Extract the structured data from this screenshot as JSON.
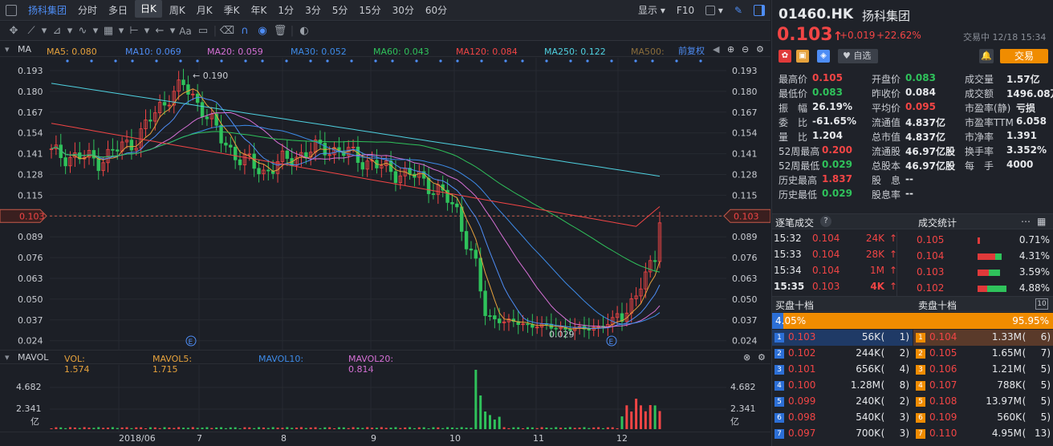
{
  "toolbar": {
    "stock_name": "扬科集团",
    "periods": [
      "分时",
      "多日",
      "日K",
      "周K",
      "月K",
      "季K",
      "年K",
      "1分",
      "3分",
      "5分",
      "15分",
      "30分",
      "60分"
    ],
    "selected_period": "日K",
    "display_label": "显示",
    "f10_label": "F10"
  },
  "ma_legend": {
    "title": "MA",
    "items": [
      {
        "label": "MA5: 0.080",
        "color": "#e6a23c"
      },
      {
        "label": "MA10: 0.069",
        "color": "#4e8df5"
      },
      {
        "label": "MA20: 0.059",
        "color": "#d670d6"
      },
      {
        "label": "MA30: 0.052",
        "color": "#3d8be8"
      },
      {
        "label": "MA60: 0.043",
        "color": "#2fc25b"
      },
      {
        "label": "MA120: 0.084",
        "color": "#f24545"
      },
      {
        "label": "MA250: 0.122",
        "color": "#4fd1e0"
      },
      {
        "label": "MA500:",
        "color": "#8a6d3b"
      }
    ],
    "adjust_label": "前复权"
  },
  "price_axis": {
    "ticks": [
      "0.193",
      "0.180",
      "0.167",
      "0.154",
      "0.141",
      "0.128",
      "0.115",
      "0.103",
      "0.089",
      "0.076",
      "0.063",
      "0.050",
      "0.037",
      "0.024"
    ],
    "current": "0.103"
  },
  "chart_annotations": {
    "high_label": "0.190",
    "low_label": "0.029",
    "event_marker": "E"
  },
  "vol_legend": {
    "title": "MAVOL",
    "items": [
      {
        "label": "VOL: 1.574",
        "color": "#e6a23c"
      },
      {
        "label": "MAVOL5: 1.715",
        "color": "#e6a23c"
      },
      {
        "label": "MAVOL10:",
        "color": "#3d8be8"
      },
      {
        "label": "MAVOL20: 0.814",
        "color": "#d670d6"
      }
    ]
  },
  "vol_axis": {
    "ticks": [
      "4.682",
      "2.341"
    ],
    "unit": "亿"
  },
  "x_axis": [
    "2018/06",
    "7",
    "8",
    "9",
    "10",
    "11",
    "12"
  ],
  "quote": {
    "code": "01460.HK",
    "name": "扬科集团",
    "price": "0.103",
    "change": "+0.019",
    "change_pct": "+22.62%",
    "status": "交易中 12/18 15:34",
    "watch_label": "自选",
    "trade_label": "交易"
  },
  "stats": [
    [
      {
        "k": "最高价",
        "v": "0.105",
        "c": "red"
      },
      {
        "k": "开盘价",
        "v": "0.083",
        "c": "green"
      },
      {
        "k": "成交量",
        "v": "1.57亿",
        "c": "white"
      }
    ],
    [
      {
        "k": "最低价",
        "v": "0.083",
        "c": "green"
      },
      {
        "k": "昨收价",
        "v": "0.084",
        "c": "white"
      },
      {
        "k": "成交额",
        "v": "1496.08万",
        "c": "white"
      }
    ],
    [
      {
        "k": "振　幅",
        "v": "26.19%",
        "c": "white"
      },
      {
        "k": "平均价",
        "v": "0.095",
        "c": "red"
      },
      {
        "k": "市盈率(静)",
        "v": "亏损",
        "c": "white"
      }
    ],
    [
      {
        "k": "委　比",
        "v": "-61.65%",
        "c": "white"
      },
      {
        "k": "流通值",
        "v": "4.837亿",
        "c": "white"
      },
      {
        "k": "市盈率TTM",
        "v": "6.058",
        "c": "white"
      }
    ],
    [
      {
        "k": "量　比",
        "v": "1.204",
        "c": "white"
      },
      {
        "k": "总市值",
        "v": "4.837亿",
        "c": "white"
      },
      {
        "k": "市净率",
        "v": "1.391",
        "c": "white"
      }
    ],
    [
      {
        "k": "52周最高",
        "v": "0.200",
        "c": "red"
      },
      {
        "k": "流通股",
        "v": "46.97亿股",
        "c": "white"
      },
      {
        "k": "换手率",
        "v": "3.352%",
        "c": "white"
      }
    ],
    [
      {
        "k": "52周最低",
        "v": "0.029",
        "c": "green"
      },
      {
        "k": "总股本",
        "v": "46.97亿股",
        "c": "white"
      },
      {
        "k": "每　手",
        "v": "4000",
        "c": "white"
      }
    ],
    [
      {
        "k": "历史最高",
        "v": "1.837",
        "c": "red"
      },
      {
        "k": "股　息",
        "v": "--",
        "c": "white"
      },
      {
        "k": "",
        "v": "",
        "c": "white"
      }
    ],
    [
      {
        "k": "历史最低",
        "v": "0.029",
        "c": "green"
      },
      {
        "k": "股息率",
        "v": "--",
        "c": "white"
      },
      {
        "k": "",
        "v": "",
        "c": "white"
      }
    ]
  ],
  "ticks_section": {
    "title": "逐笔成交",
    "stats_title": "成交统计"
  },
  "trades": [
    {
      "time": "15:32",
      "price": "0.104",
      "vol": "24K"
    },
    {
      "time": "15:33",
      "price": "0.104",
      "vol": "28K"
    },
    {
      "time": "15:34",
      "price": "0.104",
      "vol": "1M"
    },
    {
      "time": "15:35",
      "price": "0.103",
      "vol": "4K"
    }
  ],
  "deal_stats": [
    {
      "price": "0.105",
      "pct": "0.71%",
      "red": 0.05,
      "green": 0
    },
    {
      "price": "0.104",
      "pct": "4.31%",
      "red": 0.55,
      "green": 0.2
    },
    {
      "price": "0.103",
      "pct": "3.59%",
      "red": 0.35,
      "green": 0.35
    },
    {
      "price": "0.102",
      "pct": "4.88%",
      "red": 0.3,
      "green": 0.6
    }
  ],
  "book": {
    "bid_title": "买盘十档",
    "ask_title": "卖盘十档",
    "badge": "10",
    "bid_pct": "4.05%",
    "ask_pct": "95.95%",
    "bid_ratio": 0.0405,
    "bids": [
      {
        "n": "1",
        "p": "0.103",
        "v": "56K",
        "c": "1"
      },
      {
        "n": "2",
        "p": "0.102",
        "v": "244K",
        "c": "2"
      },
      {
        "n": "3",
        "p": "0.101",
        "v": "656K",
        "c": "4"
      },
      {
        "n": "4",
        "p": "0.100",
        "v": "1.28M",
        "c": "8"
      },
      {
        "n": "5",
        "p": "0.099",
        "v": "240K",
        "c": "2"
      },
      {
        "n": "6",
        "p": "0.098",
        "v": "540K",
        "c": "3"
      },
      {
        "n": "7",
        "p": "0.097",
        "v": "700K",
        "c": "3"
      }
    ],
    "asks": [
      {
        "n": "1",
        "p": "0.104",
        "v": "1.33M",
        "c": "6"
      },
      {
        "n": "2",
        "p": "0.105",
        "v": "1.65M",
        "c": "7"
      },
      {
        "n": "3",
        "p": "0.106",
        "v": "1.21M",
        "c": "5"
      },
      {
        "n": "4",
        "p": "0.107",
        "v": "788K",
        "c": "5"
      },
      {
        "n": "5",
        "p": "0.108",
        "v": "13.97M",
        "c": "5"
      },
      {
        "n": "6",
        "p": "0.109",
        "v": "560K",
        "c": "5"
      },
      {
        "n": "7",
        "p": "0.110",
        "v": "4.95M",
        "c": "13"
      }
    ]
  }
}
